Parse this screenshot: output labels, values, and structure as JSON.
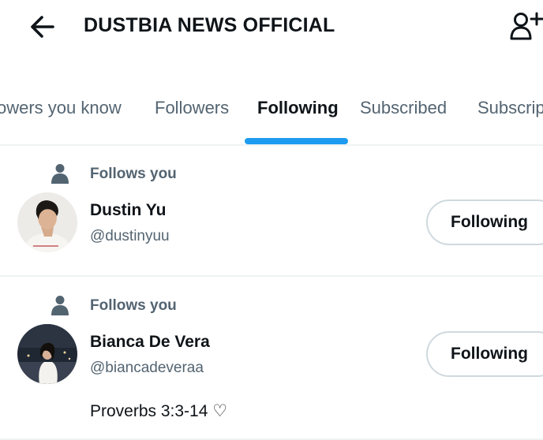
{
  "header": {
    "title": "DUSTBIA NEWS OFFICIAL",
    "back_icon": "arrow-left-icon",
    "add_icon": "add-user-icon"
  },
  "tabs": [
    {
      "label": "Followers you know",
      "shown": "owers you know",
      "active": false
    },
    {
      "label": "Followers",
      "active": false
    },
    {
      "label": "Following",
      "active": true
    },
    {
      "label": "Subscribed",
      "active": false
    },
    {
      "label": "Subscriptions",
      "shown": "Subscrip",
      "active": false
    }
  ],
  "users": [
    {
      "context": "Follows you",
      "name": "Dustin Yu",
      "handle": "@dustinyuu",
      "button": "Following",
      "bio": ""
    },
    {
      "context": "Follows you",
      "name": "Bianca De Vera",
      "handle": "@biancadeveraa",
      "button": "Following",
      "bio": "Proverbs 3:3-14 ♡"
    }
  ],
  "colors": {
    "accent": "#1d9bf0",
    "text_primary": "#0f1419",
    "text_secondary": "#536471",
    "border": "#cfd9de",
    "divider": "#eff3f4"
  }
}
